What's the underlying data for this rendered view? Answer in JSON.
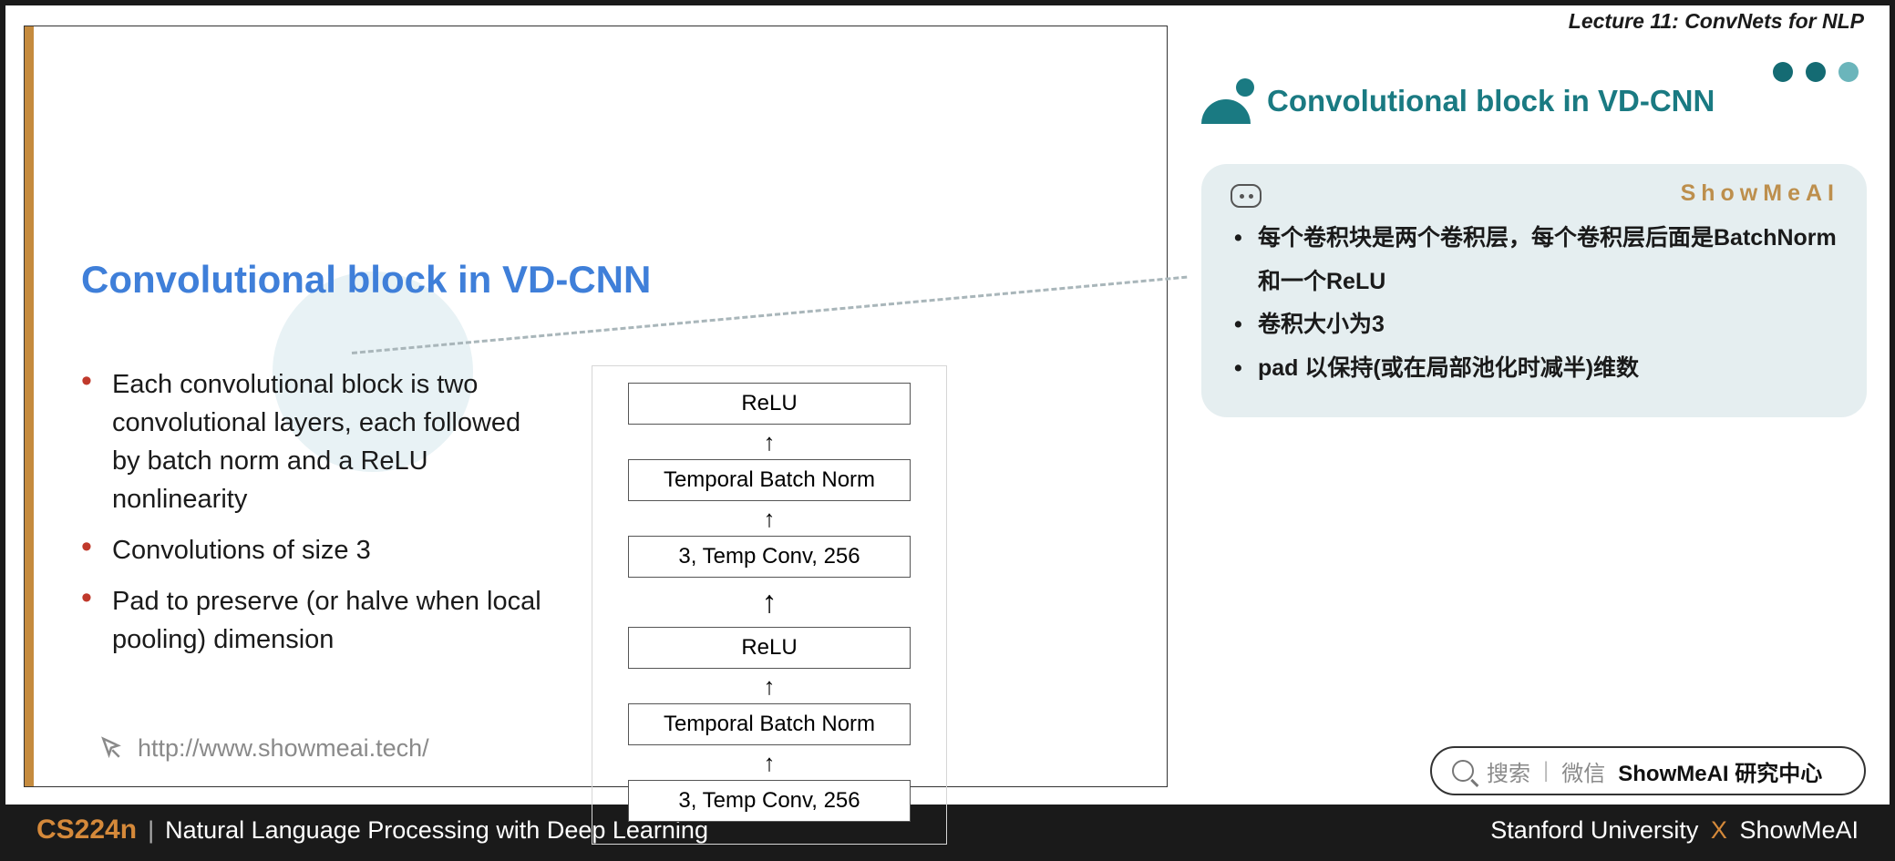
{
  "header": {
    "lecture_label": "Lecture 11: ConvNets for NLP"
  },
  "slide": {
    "title": "Convolutional block in VD-CNN",
    "bullets": [
      "Each convolutional block is two convolutional layers, each followed by batch norm and a ReLU nonlinearity",
      "Convolutions of size 3",
      "Pad to preserve (or halve when local pooling) dimension"
    ],
    "diagram": [
      "ReLU",
      "Temporal Batch Norm",
      "3, Temp Conv, 256",
      "ReLU",
      "Temporal Batch Norm",
      "3, Temp Conv, 256"
    ],
    "footer_url": "http://www.showmeai.tech/"
  },
  "right": {
    "title": "Convolutional block in VD-CNN",
    "brand": "ShowMeAI",
    "notes": [
      "每个卷积块是两个卷积层，每个卷积层后面是BatchNorm和一个ReLU",
      "卷积大小为3",
      "pad 以保持(或在局部池化时减半)维数"
    ]
  },
  "search": {
    "action": "搜索",
    "channel": "微信",
    "target": "ShowMeAI 研究中心"
  },
  "footer": {
    "course_code": "CS224n",
    "course_name": "Natural Language Processing with Deep Learning",
    "org": "Stanford University",
    "collab": "ShowMeAI"
  }
}
